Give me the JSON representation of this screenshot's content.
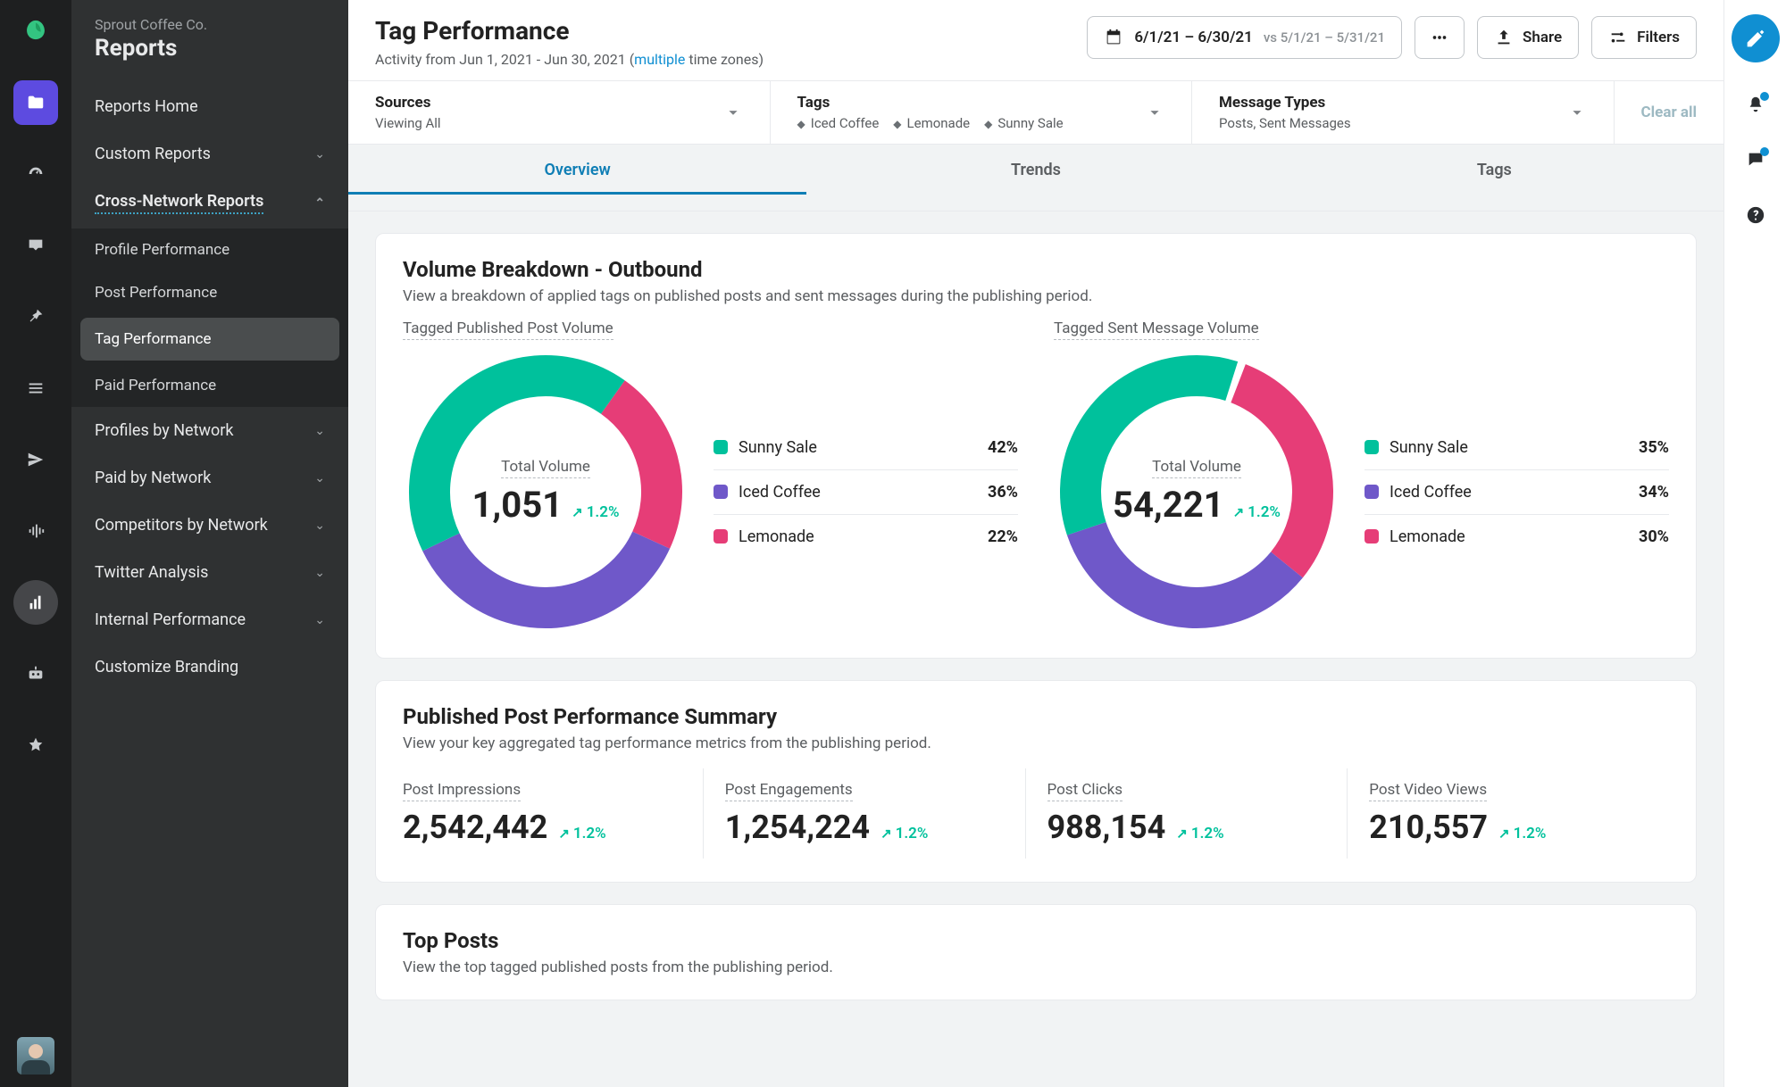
{
  "company": "Sprout Coffee Co.",
  "section_title": "Reports",
  "page": {
    "title": "Tag Performance",
    "subtitle_prefix": "Activity from Jun 1, 2021 - Jun 30, 2021 (",
    "subtitle_link": "multiple",
    "subtitle_suffix": " time zones)"
  },
  "toolbar": {
    "date_range": "6/1/21 – 6/30/21",
    "compare": "vs 5/1/21 – 5/31/21",
    "share": "Share",
    "filters": "Filters"
  },
  "filters": {
    "sources": {
      "label": "Sources",
      "value": "Viewing All"
    },
    "tags": {
      "label": "Tags",
      "items": [
        "Iced Coffee",
        "Lemonade",
        "Sunny Sale"
      ]
    },
    "types": {
      "label": "Message Types",
      "value": "Posts, Sent Messages"
    },
    "clear": "Clear all"
  },
  "tabs": [
    "Overview",
    "Trends",
    "Tags"
  ],
  "sidebar": {
    "items": [
      {
        "label": "Reports Home"
      },
      {
        "label": "Custom Reports",
        "chev": true
      },
      {
        "label": "Cross-Network Reports",
        "chev": true,
        "open": true,
        "accent": true,
        "children": [
          {
            "label": "Profile Performance"
          },
          {
            "label": "Post Performance"
          },
          {
            "label": "Tag Performance",
            "active": true
          },
          {
            "label": "Paid Performance"
          }
        ]
      },
      {
        "label": "Profiles by Network",
        "chev": true
      },
      {
        "label": "Paid by Network",
        "chev": true
      },
      {
        "label": "Competitors by Network",
        "chev": true
      },
      {
        "label": "Twitter Analysis",
        "chev": true
      },
      {
        "label": "Internal Performance",
        "chev": true
      },
      {
        "label": "Customize Branding"
      }
    ]
  },
  "volume": {
    "title": "Volume Breakdown - Outbound",
    "desc": "View a breakdown of applied tags on published posts and sent messages during the publishing period.",
    "charts": [
      {
        "label": "Tagged Published Post Volume",
        "center_label": "Total Volume",
        "total": "1,051",
        "trend": "1.2%",
        "legend": [
          {
            "name": "Sunny Sale",
            "pct": "42%",
            "color": "#00c19c"
          },
          {
            "name": "Iced Coffee",
            "pct": "36%",
            "color": "#6f58c9"
          },
          {
            "name": "Lemonade",
            "pct": "22%",
            "color": "#e63d77"
          }
        ]
      },
      {
        "label": "Tagged Sent Message Volume",
        "center_label": "Total Volume",
        "total": "54,221",
        "trend": "1.2%",
        "legend": [
          {
            "name": "Sunny Sale",
            "pct": "35%",
            "color": "#00c19c"
          },
          {
            "name": "Iced Coffee",
            "pct": "34%",
            "color": "#6f58c9"
          },
          {
            "name": "Lemonade",
            "pct": "30%",
            "color": "#e63d77"
          }
        ]
      }
    ]
  },
  "summary": {
    "title": "Published Post Performance Summary",
    "desc": "View your key aggregated tag performance metrics from the publishing period.",
    "metrics": [
      {
        "label": "Post Impressions",
        "value": "2,542,442",
        "trend": "1.2%"
      },
      {
        "label": "Post Engagements",
        "value": "1,254,224",
        "trend": "1.2%"
      },
      {
        "label": "Post Clicks",
        "value": "988,154",
        "trend": "1.2%"
      },
      {
        "label": "Post Video Views",
        "value": "210,557",
        "trend": "1.2%"
      }
    ]
  },
  "topposts": {
    "title": "Top Posts",
    "desc": "View the top tagged published posts from the publishing period."
  },
  "chart_data": [
    {
      "type": "pie",
      "title": "Tagged Published Post Volume",
      "total": 1051,
      "series": [
        {
          "name": "Sunny Sale",
          "value": 42
        },
        {
          "name": "Iced Coffee",
          "value": 36
        },
        {
          "name": "Lemonade",
          "value": 22
        }
      ],
      "unit": "percent"
    },
    {
      "type": "pie",
      "title": "Tagged Sent Message Volume",
      "total": 54221,
      "series": [
        {
          "name": "Sunny Sale",
          "value": 35
        },
        {
          "name": "Iced Coffee",
          "value": 34
        },
        {
          "name": "Lemonade",
          "value": 30
        }
      ],
      "unit": "percent"
    }
  ]
}
